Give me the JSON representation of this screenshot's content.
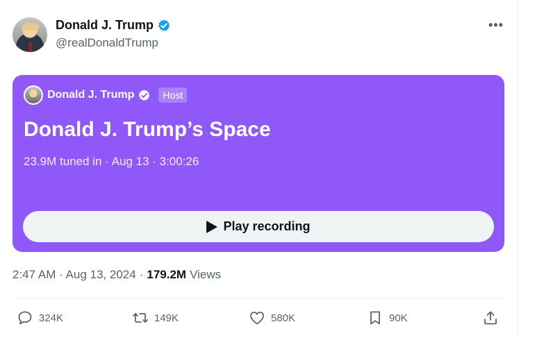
{
  "tweet": {
    "author_name": "Donald J. Trump",
    "author_handle": "@realDonaldTrump",
    "more_label": "•••",
    "timestamp": "2:47 AM · Aug 13, 2024",
    "separator": "·",
    "views_count": "179.2M",
    "views_label": "Views"
  },
  "space": {
    "host_name": "Donald J. Trump",
    "host_badge": "Host",
    "title": "Donald J. Trump’s Space",
    "meta": "23.9M tuned in · Aug 13 · 3:00:26",
    "play_label": "Play recording"
  },
  "actions": {
    "replies": "324K",
    "retweets": "149K",
    "likes": "580K",
    "bookmarks": "90K"
  },
  "icons": {
    "verified": "verified-badge-icon",
    "reply": "speech-bubble-icon",
    "retweet": "retweet-arrows-icon",
    "like": "heart-icon",
    "bookmark": "bookmark-icon",
    "share": "share-upload-icon",
    "play": "play-triangle-icon"
  },
  "colors": {
    "space_card": "#9058f8",
    "verified_blue": "#1d9bf0",
    "text_secondary": "#536471",
    "text_primary": "#0f1419"
  }
}
